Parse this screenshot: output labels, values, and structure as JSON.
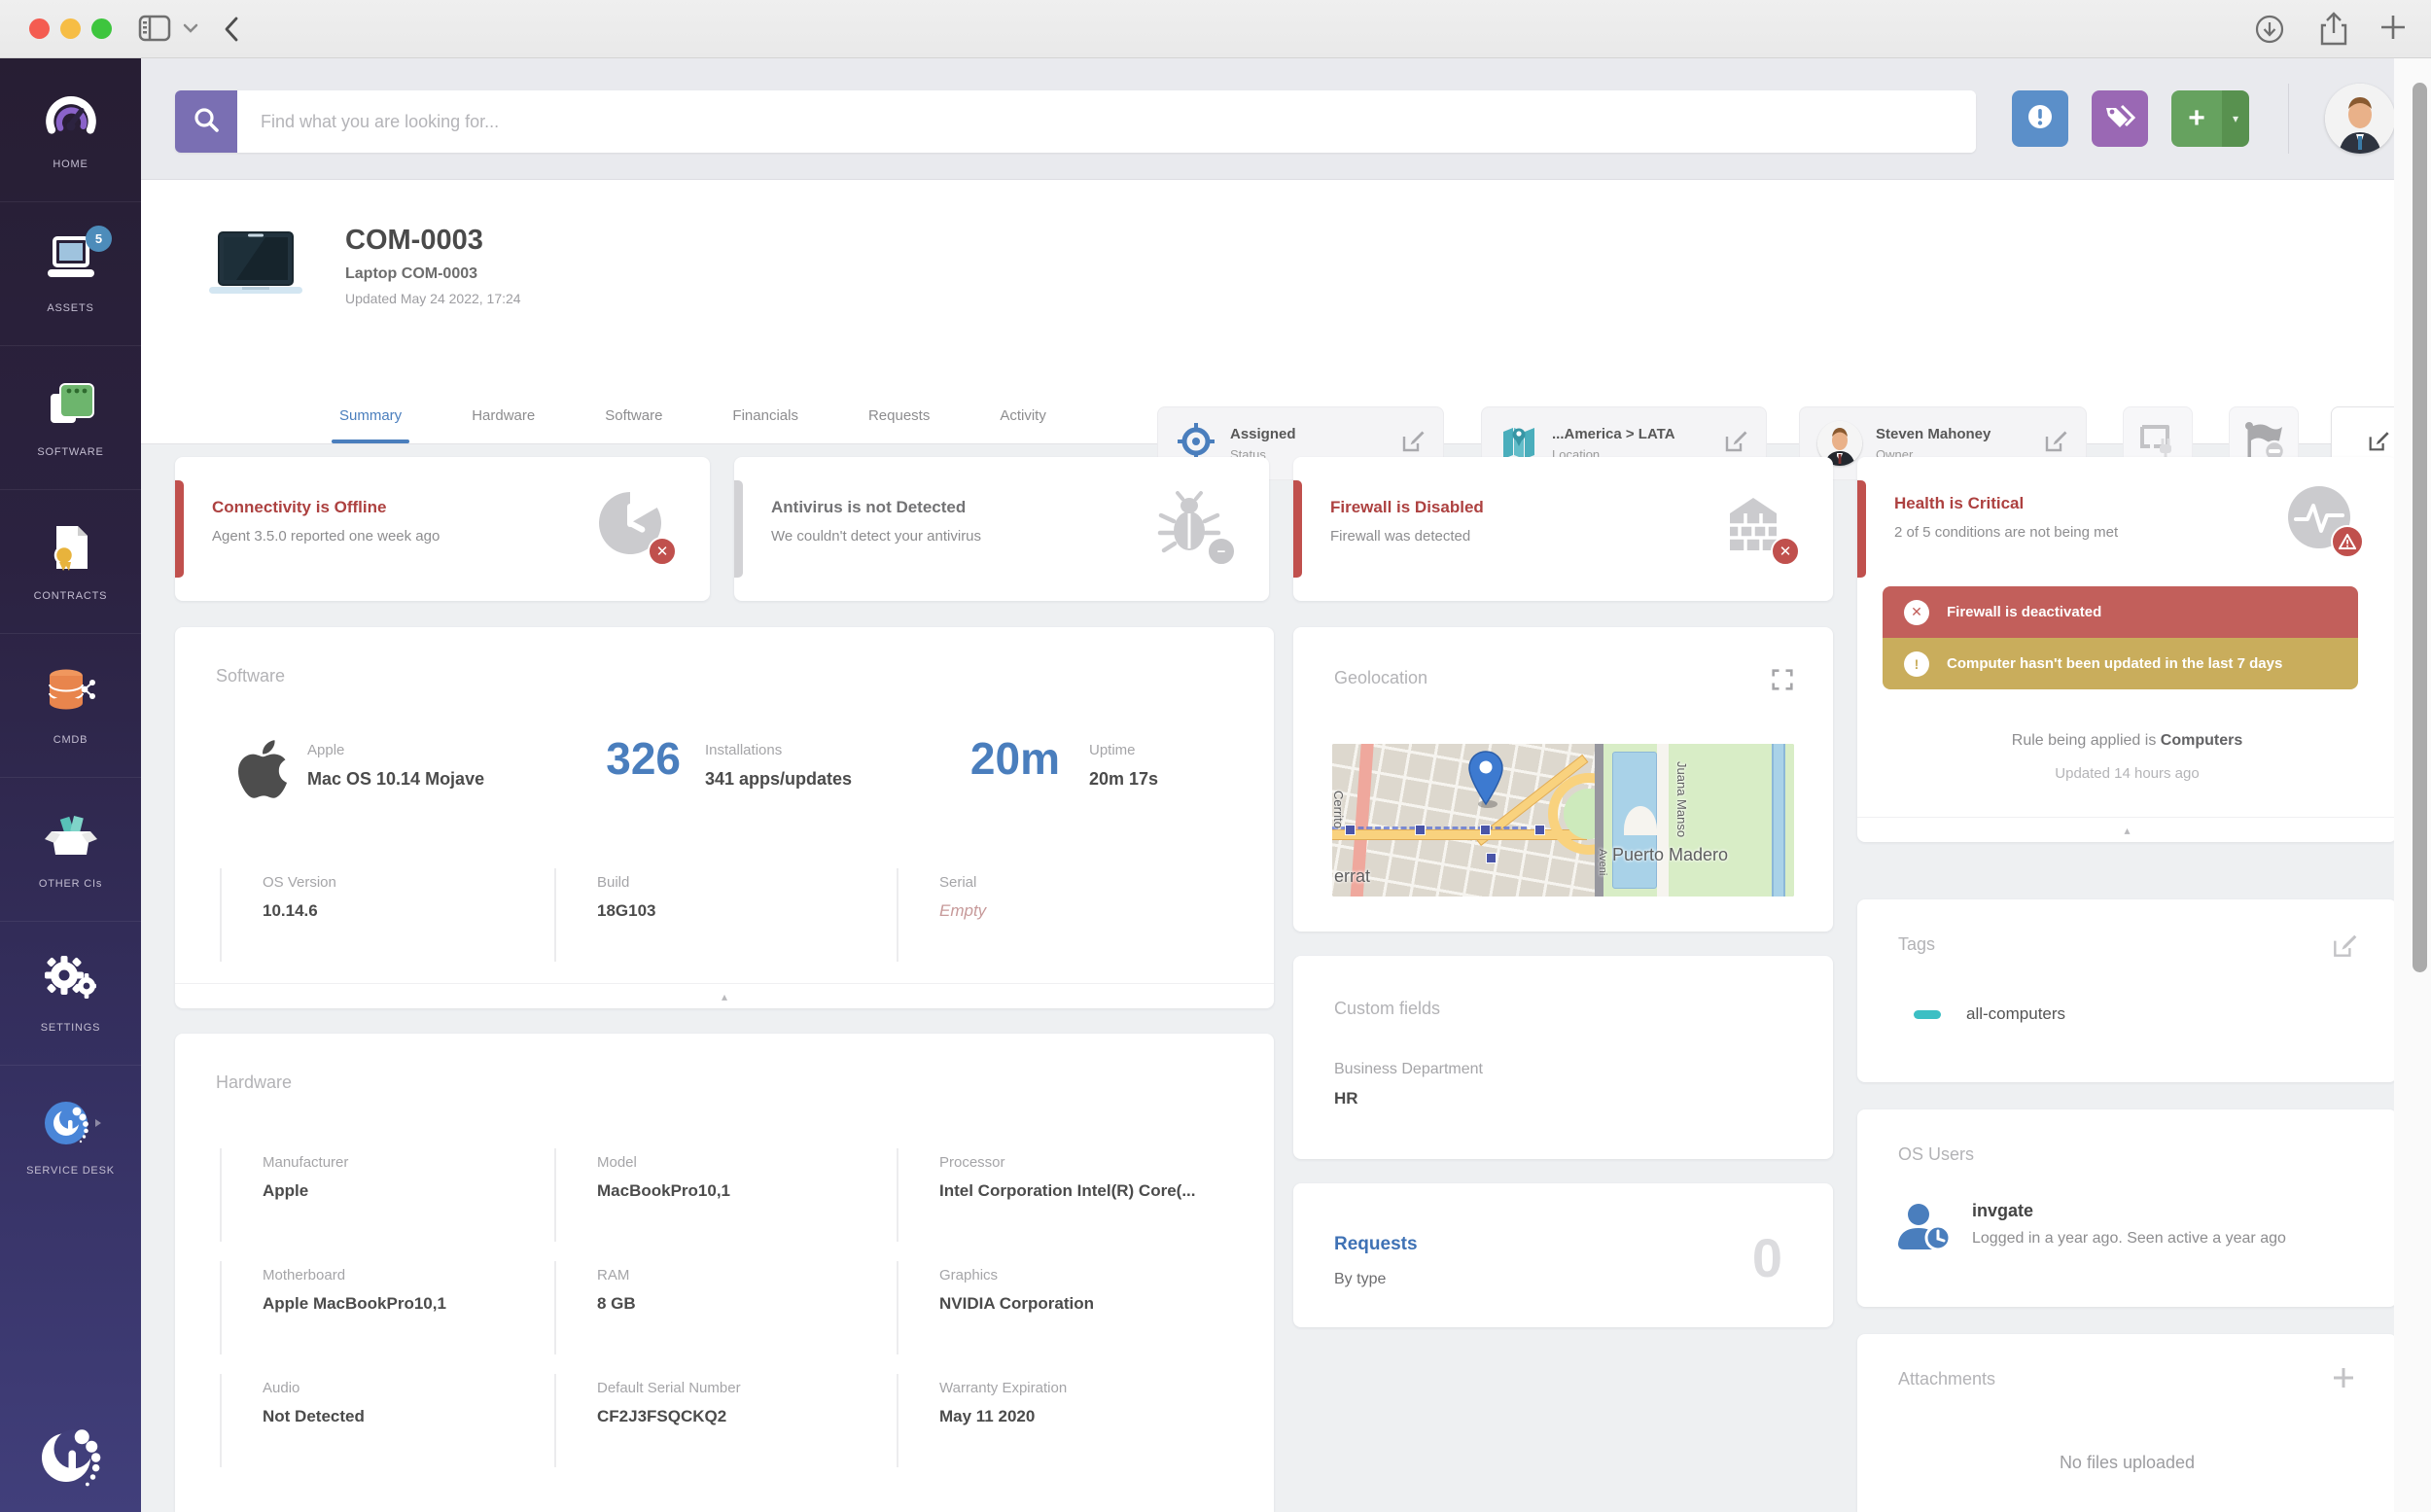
{
  "toolbar": {
    "search_placeholder": "Find what you are looking for..."
  },
  "sidebar": {
    "items": [
      {
        "label": "HOME"
      },
      {
        "label": "ASSETS",
        "badge": "5"
      },
      {
        "label": "SOFTWARE"
      },
      {
        "label": "CONTRACTS"
      },
      {
        "label": "CMDB"
      },
      {
        "label": "OTHER CIs"
      },
      {
        "label": "SETTINGS"
      },
      {
        "label": "SERVICE DESK"
      }
    ]
  },
  "asset": {
    "id": "COM-0003",
    "name": "Laptop COM-0003",
    "updated": "Updated May 24 2022, 17:24",
    "status": {
      "value": "Assigned",
      "label": "Status"
    },
    "location": {
      "value": "...America > LATA",
      "label": "Location"
    },
    "owner": {
      "value": "Steven Mahoney",
      "label": "Owner"
    },
    "edit_label": "Edit"
  },
  "tabs": [
    {
      "label": "Summary"
    },
    {
      "label": "Hardware"
    },
    {
      "label": "Software"
    },
    {
      "label": "Financials"
    },
    {
      "label": "Requests"
    },
    {
      "label": "Activity"
    }
  ],
  "alerts": [
    {
      "title": "Connectivity is Offline",
      "subtitle": "Agent 3.5.0 reported one week ago"
    },
    {
      "title": "Antivirus is not Detected",
      "subtitle": "We couldn't detect your antivirus"
    },
    {
      "title": "Firewall is Disabled",
      "subtitle": "Firewall was detected"
    }
  ],
  "health": {
    "title": "Health is Critical",
    "subtitle": "2 of 5 conditions are not being met",
    "banners": [
      {
        "text": "Firewall is deactivated"
      },
      {
        "text": "Computer hasn't been updated in the last 7 days"
      }
    ],
    "rule_prefix": "Rule being applied is ",
    "rule_name": "Computers",
    "updated": "Updated 14 hours ago"
  },
  "software_panel": {
    "title": "Software",
    "vendor": "Apple",
    "os": "Mac OS 10.14 Mojave",
    "installations": {
      "value": "326",
      "label": "Installations",
      "sub": "341 apps/updates"
    },
    "uptime": {
      "value": "20m",
      "label": "Uptime",
      "sub": "20m 17s"
    },
    "fields": [
      {
        "label": "OS Version",
        "value": "10.14.6"
      },
      {
        "label": "Build",
        "value": "18G103"
      },
      {
        "label": "Serial",
        "value": "Empty"
      }
    ]
  },
  "hardware_panel": {
    "title": "Hardware",
    "fields": [
      {
        "label": "Manufacturer",
        "value": "Apple"
      },
      {
        "label": "Model",
        "value": "MacBookPro10,1"
      },
      {
        "label": "Processor",
        "value": "Intel Corporation Intel(R) Core(..."
      },
      {
        "label": "Motherboard",
        "value": "Apple MacBookPro10,1"
      },
      {
        "label": "RAM",
        "value": "8 GB"
      },
      {
        "label": "Graphics",
        "value": "NVIDIA Corporation"
      },
      {
        "label": "Audio",
        "value": "Not Detected"
      },
      {
        "label": "Default Serial Number",
        "value": "CF2J3FSQCKQ2"
      },
      {
        "label": "Warranty Expiration",
        "value": "May 11 2020"
      }
    ]
  },
  "geolocation": {
    "title": "Geolocation",
    "map_labels": {
      "street_left": "Cerrito",
      "bottom_left": "errat",
      "district": "Puerto Madero",
      "street_right": "Juana Manso",
      "avenue": "Aveni"
    }
  },
  "custom_fields": {
    "title": "Custom fields",
    "fields": [
      {
        "label": "Business Department",
        "value": "HR"
      }
    ]
  },
  "requests": {
    "title": "Requests",
    "subtitle": "By type",
    "count": "0"
  },
  "tags": {
    "title": "Tags",
    "items": [
      {
        "label": "all-computers"
      }
    ]
  },
  "os_users": {
    "title": "OS Users",
    "users": [
      {
        "name": "invgate",
        "info": "Logged in a year ago. Seen active a year ago"
      }
    ]
  },
  "attachments": {
    "title": "Attachments",
    "empty": "No files uploaded"
  },
  "icons": {
    "search": "magnifier",
    "info": "exclamation-circle",
    "tags": "double-tag",
    "add": "plus",
    "status": "target",
    "location": "map-pin",
    "edit": "pencil",
    "settings": "gear",
    "connectivity": "clock",
    "antivirus": "bug",
    "firewall": "brick-wall",
    "health": "pulse-circle",
    "expand": "fullscreen-corners",
    "attachments_add": "plus",
    "collapse": "triangle-up"
  },
  "colors": {
    "accent_blue": "#4a7ebd",
    "alert_red": "#ad4140",
    "bar_red": "#c0504d",
    "banner_red": "#c25f5b",
    "banner_yellow": "#c9ad5c",
    "tag_teal": "#3cbfc4",
    "sidebar_top": "#271e33",
    "sidebar_bottom": "#413f7b",
    "search_purple": "#7a6fb3",
    "info_button": "#5b8fc9",
    "tag_button": "#9a68b4",
    "green_button": "#66a25f"
  }
}
